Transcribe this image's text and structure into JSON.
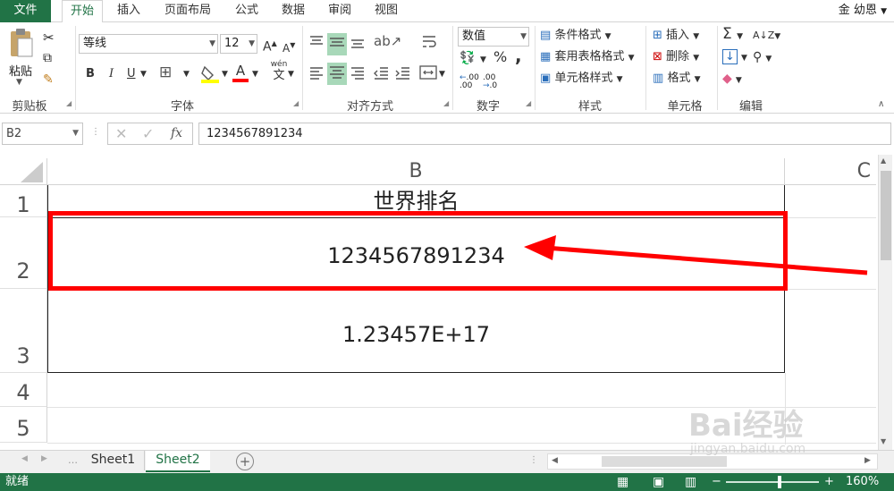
{
  "tabs": [
    "文件",
    "开始",
    "插入",
    "页面布局",
    "公式",
    "数据",
    "审阅",
    "视图"
  ],
  "user": "金 幼恩",
  "clipboard": {
    "paste": "粘贴",
    "label": "剪贴板"
  },
  "font": {
    "name": "等线",
    "size": "12",
    "label": "字体",
    "bold": "B",
    "italic": "I",
    "underline": "U",
    "grow": "A",
    "shrink": "A",
    "color_a": "A",
    "wen": "wén",
    "wen_char": "文"
  },
  "alignment": {
    "label": "对齐方式"
  },
  "number": {
    "format": "数值",
    "label": "数字",
    "percent": "%",
    "comma": ",",
    "inc": ".00",
    "dec": ".00"
  },
  "styles": {
    "conditional": "条件格式",
    "table": "套用表格格式",
    "cell": "单元格样式",
    "label": "样式"
  },
  "cells": {
    "insert": "插入",
    "delete": "删除",
    "format": "格式",
    "label": "单元格"
  },
  "editing": {
    "label": "编辑",
    "sigma": "Σ"
  },
  "formula_bar": {
    "name_box": "B2",
    "fx": "fx",
    "value": "1234567891234"
  },
  "columns": [
    "B",
    "C"
  ],
  "rows": [
    "1",
    "2",
    "3",
    "4",
    "5"
  ],
  "cells_data": {
    "b1": "世界排名",
    "b2": "1234567891234",
    "b3": "1.23457E+17"
  },
  "sheets": [
    "Sheet1",
    "Sheet2"
  ],
  "status": {
    "ready": "就绪",
    "zoom": "160%"
  },
  "watermark": {
    "line1": "Bai经验",
    "line2": "jingyan.baidu.com"
  },
  "colors": {
    "accent": "#217346",
    "highlight": "#ff0000"
  }
}
